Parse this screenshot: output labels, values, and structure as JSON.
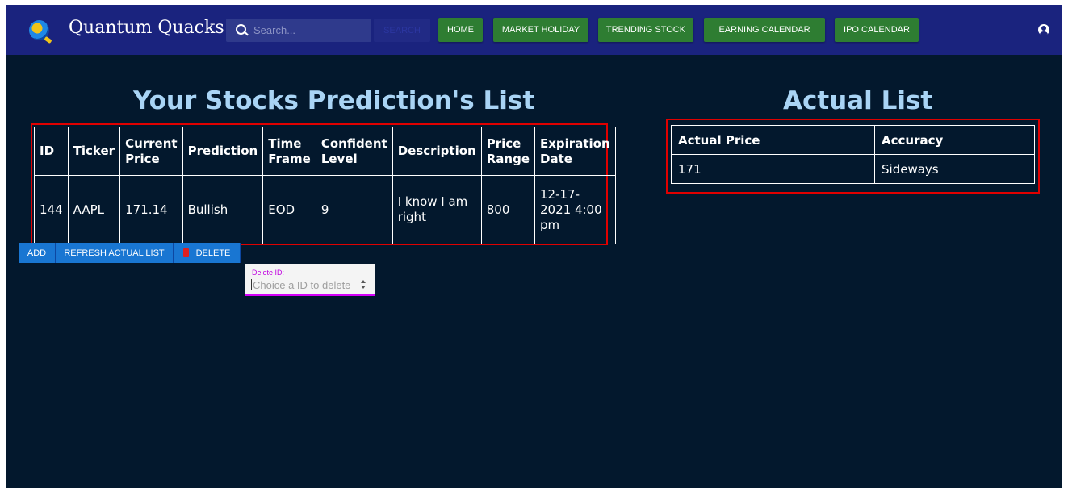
{
  "header": {
    "brand": "Quantum Quacks",
    "search_placeholder": "Search...",
    "search_button": "SEARCH",
    "nav": {
      "home": "HOME",
      "market_holiday": "MARKET HOLIDAY",
      "trending_stock": "TRENDING STOCK",
      "earning_calendar": "EARNING CALENDAR",
      "ipo_calendar": "IPO CALENDAR"
    }
  },
  "prediction": {
    "heading": "Your Stocks Prediction's List",
    "columns": {
      "id": "ID",
      "ticker": "Ticker",
      "current_price": "Current Price",
      "prediction": "Prediction",
      "time_frame": "Time Frame",
      "confident_level": "Confident Level",
      "description": "Description",
      "price_range": "Price Range",
      "expiration_date": "Expiration Date"
    },
    "rows": [
      {
        "id": "144",
        "ticker": "AAPL",
        "current_price": "171.14",
        "prediction": "Bullish",
        "time_frame": "EOD",
        "confident_level": "9",
        "description": "I know I am right",
        "price_range": "800",
        "expiration_date": "12-17-2021 4:00 pm"
      }
    ]
  },
  "actual": {
    "heading": "Actual List",
    "columns": {
      "actual_price": "Actual Price",
      "accuracy": "Accuracy"
    },
    "rows": [
      {
        "actual_price": "171",
        "accuracy": "Sideways"
      }
    ]
  },
  "actions": {
    "add": "ADD",
    "refresh": "REFRESH ACTUAL LIST",
    "delete": "DELETE"
  },
  "delete_field": {
    "label": "Delete ID:",
    "placeholder": "Choice a ID to delete"
  },
  "colors": {
    "background": "#03182d",
    "navbar": "#1a237e",
    "nav_button": "#2e7d32",
    "action_button": "#1976d2",
    "heading": "#a9d4f5",
    "highlight": "#e00000",
    "field_accent": "#d500f9"
  }
}
